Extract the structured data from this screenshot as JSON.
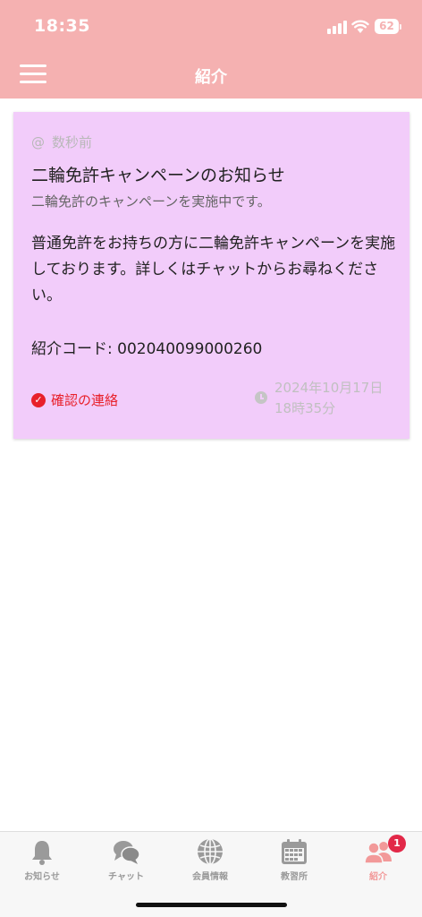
{
  "status_bar": {
    "time": "18:35",
    "battery": "62"
  },
  "header": {
    "title": "紹介"
  },
  "card": {
    "relative_time": "数秒前",
    "title": "二輪免許キャンペーンのお知らせ",
    "subtitle": "二輪免許のキャンペーンを実施中です。",
    "body": "普通免許をお持ちの方に二輪免許キャンペーンを実施しております。詳しくはチャットからお尋ねください。",
    "referral_code": "紹介コード: 002040099000260",
    "confirm_label": "確認の連絡",
    "date": "2024年10月17日",
    "time": "18時35分"
  },
  "colors": {
    "header": "#f5b1b1",
    "card": "#f2ccfa",
    "accent_red": "#e8202a",
    "tab_active": "#f29999"
  },
  "tabs": [
    {
      "label": "お知らせ",
      "icon": "bell-icon"
    },
    {
      "label": "チャット",
      "icon": "chat-bubbles-icon"
    },
    {
      "label": "会員情報",
      "icon": "globe-icon"
    },
    {
      "label": "教習所",
      "icon": "calendar-icon"
    },
    {
      "label": "紹介",
      "icon": "people-icon",
      "badge": "1",
      "active": true
    }
  ]
}
